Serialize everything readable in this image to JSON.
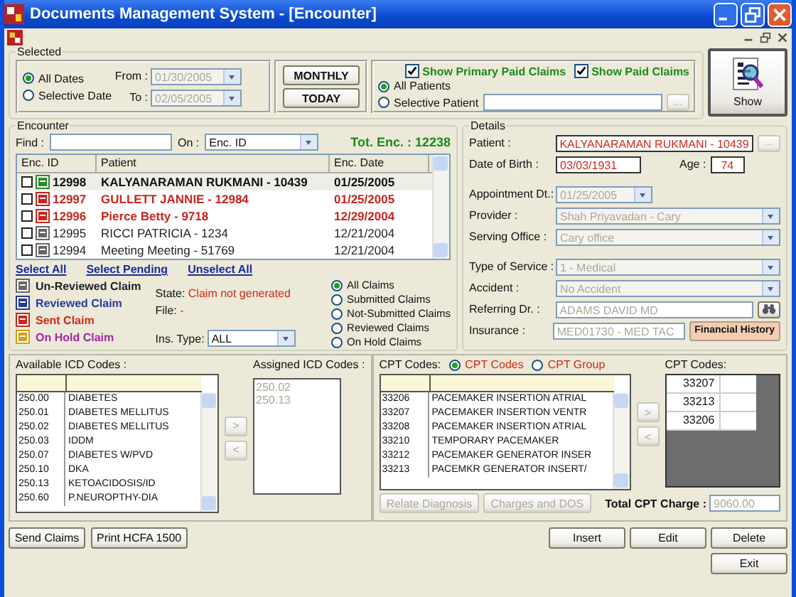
{
  "window": {
    "title": "Documents Management System - [Encounter]"
  },
  "selected": {
    "title": "Selected",
    "date_options": [
      {
        "label": "All Dates",
        "selected": true
      },
      {
        "label": "Selective Date",
        "selected": false
      }
    ],
    "from": {
      "label": "From :",
      "value": "01/30/2005"
    },
    "to": {
      "label": "To :",
      "value": "02/05/2005"
    },
    "date_buttons": [
      "MONTHLY",
      "TODAY"
    ],
    "filters": [
      {
        "label": "Show Primary Paid Claims",
        "checked": true
      },
      {
        "label": "Show Paid Claims",
        "checked": true
      }
    ],
    "patient_options": [
      {
        "label": "All Patients",
        "selected": true
      },
      {
        "label": "Selective Patient",
        "selected": false
      }
    ],
    "browse_button": "...",
    "show_button": "Show"
  },
  "encounter": {
    "title": "Encounter",
    "find_label": "Find :",
    "on_label": "On :",
    "on_value": "Enc. ID",
    "total": "Tot. Enc. : 12238",
    "columns": [
      "Enc. ID",
      "Patient",
      "Enc. Date"
    ],
    "rows": [
      {
        "kind": "primary_paid",
        "checked": false,
        "id": "12998",
        "patient": "KALYANARAMAN RUKMANI - 10439",
        "date": "01/25/2005"
      },
      {
        "kind": "sent",
        "checked": false,
        "id": "12997",
        "patient": "GULLETT JANNIE - 12984",
        "date": "01/25/2005"
      },
      {
        "kind": "sent",
        "checked": false,
        "id": "12996",
        "patient": "Pierce Betty - 9718",
        "date": "12/29/2004"
      },
      {
        "kind": "unreviewed",
        "checked": false,
        "id": "12995",
        "patient": "RICCI PATRICIA - 1234",
        "date": "12/21/2004"
      },
      {
        "kind": "unreviewed",
        "checked": false,
        "id": "12994",
        "patient": "Meeting Meeting - 51769",
        "date": "12/21/2004"
      }
    ],
    "links": [
      "Select All",
      "Select Pending",
      "Unselect All"
    ],
    "legend": [
      {
        "kind": "unreviewed",
        "label": "Un-Reviewed Claim"
      },
      {
        "kind": "reviewed",
        "label": "Reviewed Claim"
      },
      {
        "kind": "sent",
        "label": "Sent Claim"
      },
      {
        "kind": "on_hold",
        "label": "On Hold Claim"
      }
    ],
    "state_label": "State:",
    "state_value": "Claim not generated",
    "file_label": "File:",
    "file_value": "-",
    "ins_type_label": "Ins. Type:",
    "ins_type_value": "ALL",
    "claim_filters": [
      {
        "label": "All Claims",
        "selected": true
      },
      {
        "label": "Submitted Claims",
        "selected": false
      },
      {
        "label": "Not-Submitted Claims",
        "selected": false
      },
      {
        "label": "Reviewed Claims",
        "selected": false
      },
      {
        "label": "On Hold Claims",
        "selected": false
      }
    ]
  },
  "details": {
    "title": "Details",
    "patient": {
      "label": "Patient :",
      "value": "KALYANARAMAN RUKMANI - 10439"
    },
    "browse_button": "...",
    "dob": {
      "label": "Date of Birth :",
      "value": "03/03/1931"
    },
    "age": {
      "label": "Age :",
      "value": "74"
    },
    "fields": [
      {
        "kind": "date",
        "label": "Appointment Dt.:",
        "value": "01/25/2005"
      },
      {
        "kind": "dropdown",
        "label": "Provider :",
        "value": "Shah Priyavadan - Cary"
      },
      {
        "kind": "dropdown",
        "label": "Serving Office :",
        "value": "Cary office"
      },
      {
        "kind": "dropdown",
        "label": "Type of Service :",
        "value": "1 - Medical"
      },
      {
        "kind": "dropdown",
        "label": "Accident :",
        "value": "No Accident"
      },
      {
        "kind": "search",
        "label": "Referring Dr. :",
        "value": "ADAMS DAVID MD"
      },
      {
        "kind": "button",
        "label": "Insurance :",
        "value": "MED01730 - MED TAC",
        "button": "Financial History"
      }
    ]
  },
  "icd": {
    "available_label": "Available ICD Codes :",
    "rows": [
      {
        "code": "250.00",
        "desc": "DIABETES"
      },
      {
        "code": "250.01",
        "desc": "DIABETES MELLITUS"
      },
      {
        "code": "250.02",
        "desc": "DIABETES MELLITUS"
      },
      {
        "code": "250.03",
        "desc": "IDDM"
      },
      {
        "code": "250.07",
        "desc": "DIABETES W/PVD"
      },
      {
        "code": "250.10",
        "desc": "DKA"
      },
      {
        "code": "250.13",
        "desc": "KETOACIDOSIS/ID"
      },
      {
        "code": "250.60",
        "desc": "P.NEUROPTHY-DIA"
      }
    ],
    "add_button": ">",
    "remove_button": "<",
    "assigned_label": "Assigned ICD Codes :",
    "assigned": [
      "250.02",
      "250.13"
    ]
  },
  "cpt": {
    "label": "CPT Codes:",
    "options": [
      {
        "label": "CPT Codes",
        "selected": true
      },
      {
        "label": "CPT Group",
        "selected": false
      }
    ],
    "rows": [
      {
        "code": "33206",
        "desc": "PACEMAKER INSERTION ATRIAL"
      },
      {
        "code": "33207",
        "desc": "PACEMAKER INSERTION VENTR"
      },
      {
        "code": "33208",
        "desc": "PACEMAKER INSERTION ATRIAL"
      },
      {
        "code": "33210",
        "desc": "TEMPORARY PACEMAKER"
      },
      {
        "code": "33212",
        "desc": "PACEMAKER GENERATOR INSER"
      },
      {
        "code": "33213",
        "desc": "PACEMKR GENERATOR INSERT/"
      }
    ],
    "add_button": ">",
    "remove_button": "<",
    "assigned_label": "CPT Codes:",
    "assigned": [
      "33207",
      "33213",
      "33206"
    ],
    "buttons": [
      "Relate Diagnosis",
      "Charges and DOS"
    ],
    "total_label": "Total CPT Charge :",
    "total_value": "9060.00"
  },
  "left_buttons": [
    "Send Claims",
    "Print HCFA 1500"
  ],
  "right_buttons": [
    "Insert",
    "Edit",
    "Delete",
    "Exit"
  ]
}
